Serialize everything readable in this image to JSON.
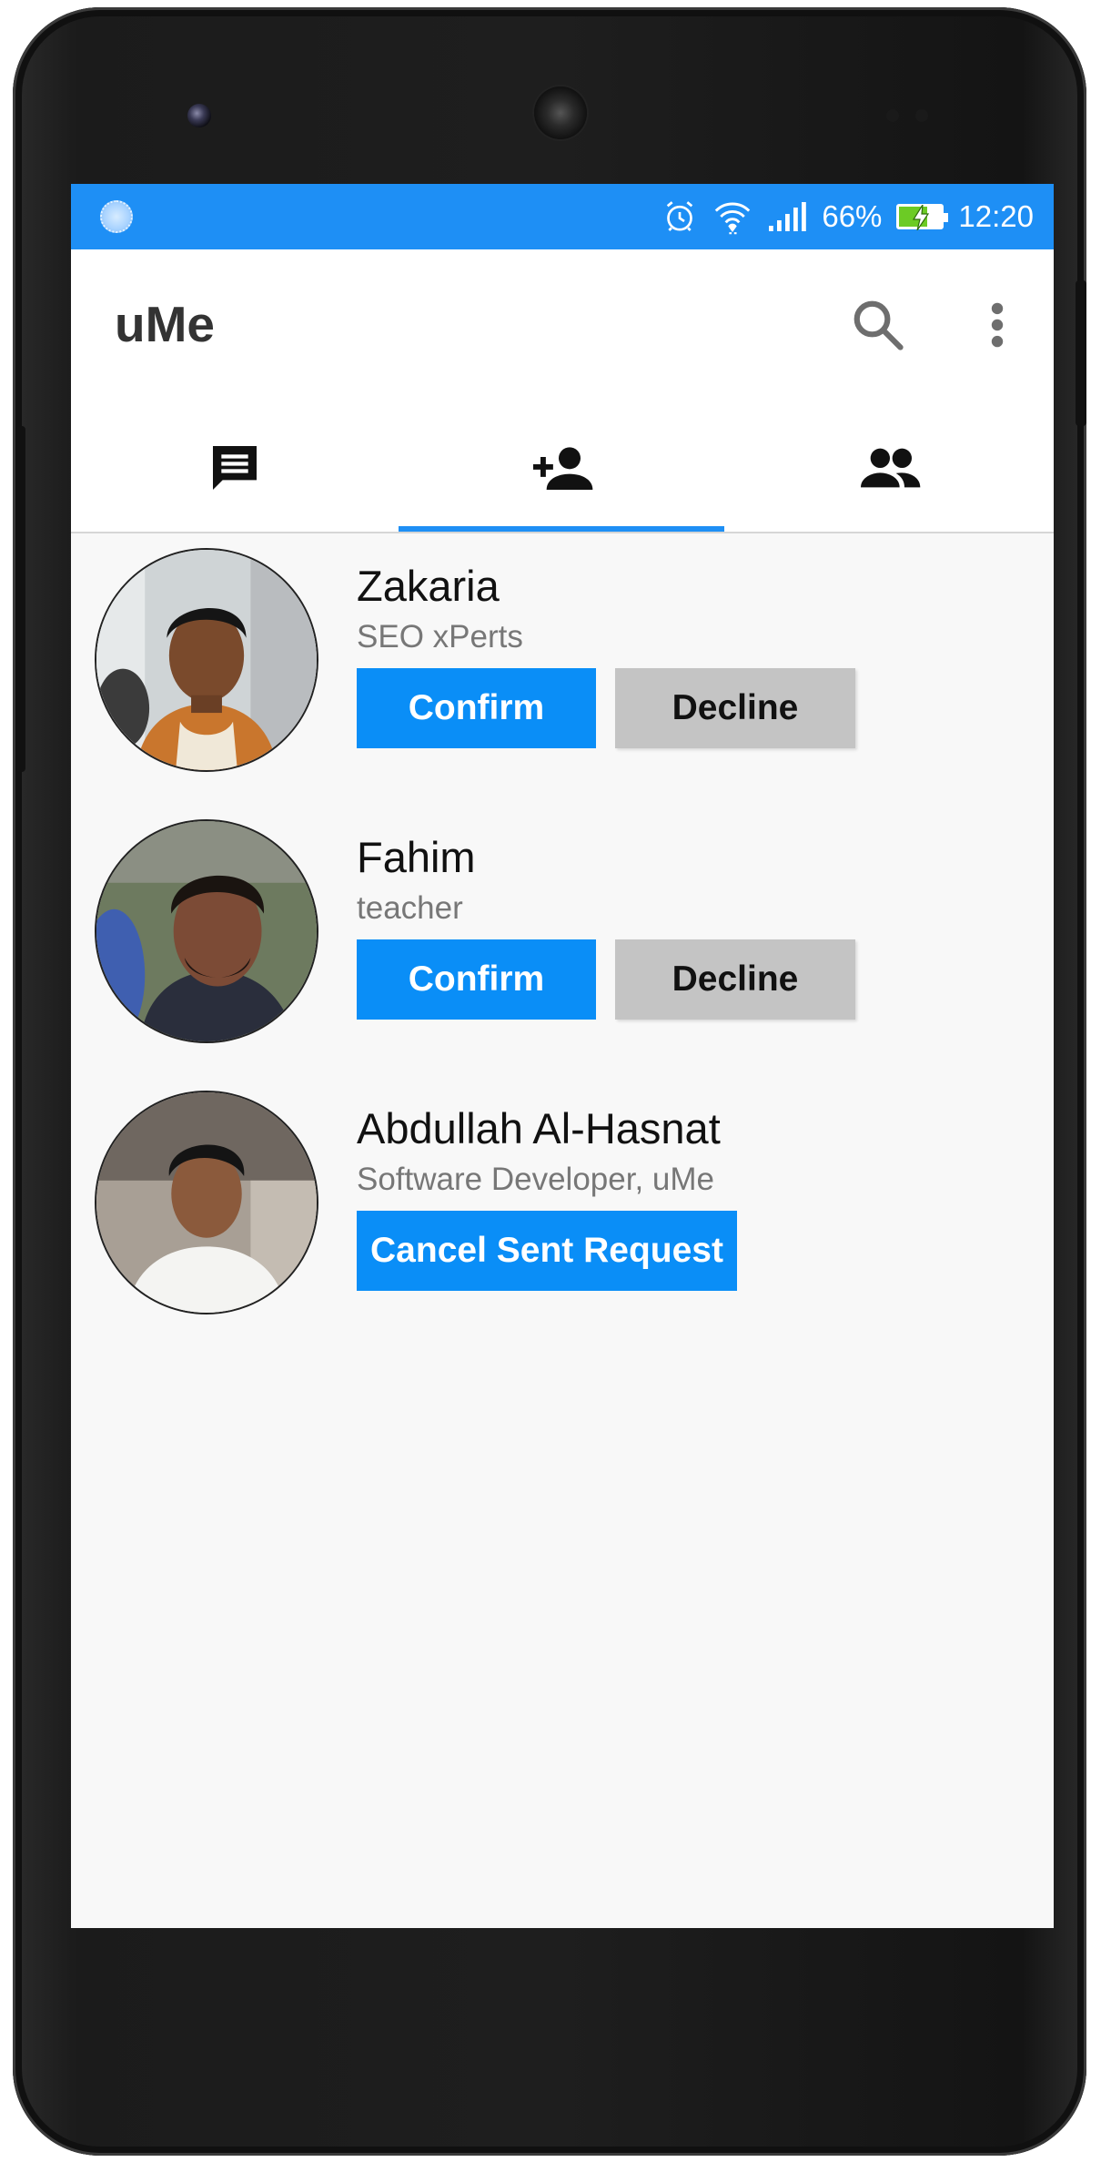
{
  "status_bar": {
    "battery": "66%",
    "battery_level": 0.66,
    "time": "12:20",
    "icons": [
      "loading-icon",
      "alarm-icon",
      "wifi-icon",
      "signal-icon",
      "battery-icon"
    ]
  },
  "app_bar": {
    "title": "uMe",
    "actions": [
      "search-icon",
      "more-vert-icon"
    ]
  },
  "tabs": {
    "items": [
      {
        "icon": "chat-icon"
      },
      {
        "icon": "person-add-icon",
        "selected": true
      },
      {
        "icon": "people-icon"
      }
    ],
    "accent": "#1e8ff5"
  },
  "requests": [
    {
      "name": "Zakaria",
      "subtitle": "SEO xPerts",
      "confirm_label": "Confirm",
      "decline_label": "Decline"
    },
    {
      "name": "Fahim",
      "subtitle": "teacher",
      "confirm_label": "Confirm",
      "decline_label": "Decline"
    },
    {
      "name": "Abdullah Al-Hasnat",
      "subtitle": "Software Developer, uMe",
      "cancel_label": "Cancel Sent Request"
    }
  ],
  "colors": {
    "primary": "#1e8ff5",
    "button_primary": "#0a8ef7",
    "button_secondary": "#c4c4c4",
    "background": "#f8f8f8"
  }
}
